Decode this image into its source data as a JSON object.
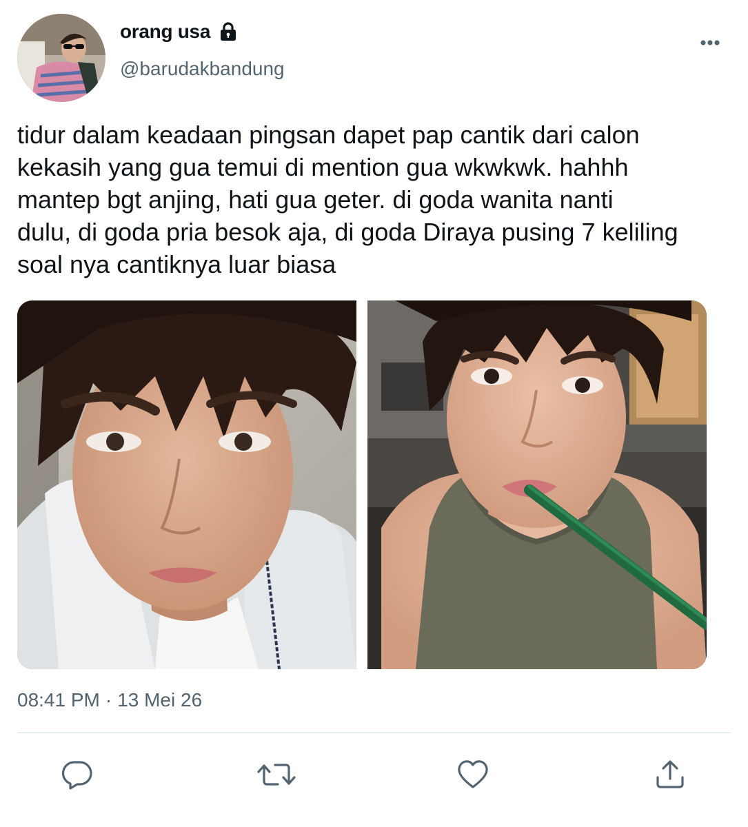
{
  "author": {
    "display_name": "orang usa",
    "handle": "@barudakbandung",
    "protected_icon": "lock-icon"
  },
  "tweet": {
    "text": "tidur dalam keadaan pingsan dapet pap cantik dari calon\nkekasih yang gua temui di mention gua wkwkwk. hahhh\nmantep bgt anjing, hati gua geter. di goda wanita nanti\ndulu, di goda pria besok aja, di goda Diraya pusing 7 keliling\nsoal nya cantiknya luar biasa",
    "time": "08:41 PM",
    "separator": "·",
    "date": "13 Mei 26"
  },
  "media": [
    {
      "kind": "photo",
      "subject": "selfie-white-jacket"
    },
    {
      "kind": "photo",
      "subject": "selfie-tank-top-straw"
    }
  ],
  "actions": [
    {
      "name": "reply",
      "icon": "reply-icon"
    },
    {
      "name": "retweet",
      "icon": "retweet-icon"
    },
    {
      "name": "like",
      "icon": "heart-icon"
    },
    {
      "name": "share",
      "icon": "share-icon"
    }
  ],
  "colors": {
    "text_primary": "#0f1419",
    "text_secondary": "#536471",
    "divider": "#cfd9de"
  }
}
